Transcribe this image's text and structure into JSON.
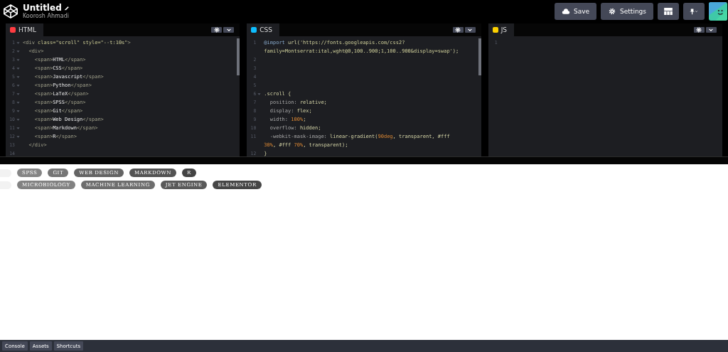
{
  "header": {
    "title": "Untitled",
    "author": "Koorosh Ahmadi",
    "buttons": [
      {
        "kind": "save",
        "label": "Save"
      },
      {
        "kind": "settings",
        "label": "Settings"
      },
      {
        "kind": "layout"
      },
      {
        "kind": "pin"
      }
    ]
  },
  "editors": [
    {
      "kind": "html",
      "title": "HTML",
      "lines": [
        {
          "number": "1",
          "fold": true,
          "segments": [
            {
              "kind": "tag",
              "text": "<div "
            },
            {
              "kind": "attr",
              "text": "class="
            },
            {
              "kind": "str",
              "text": "\"scroll\" "
            },
            {
              "kind": "attr",
              "text": "style="
            },
            {
              "kind": "str",
              "text": "\"--t:10s\""
            },
            {
              "kind": "tag",
              "text": ">"
            }
          ]
        },
        {
          "number": "2",
          "fold": true,
          "segments": [
            {
              "kind": "tag",
              "text": "  <div>"
            }
          ]
        },
        {
          "number": "3",
          "fold": true,
          "segments": [
            {
              "kind": "tag",
              "text": "    <span>"
            },
            {
              "kind": "text",
              "text": "HTML"
            },
            {
              "kind": "tag",
              "text": "</span>"
            }
          ]
        },
        {
          "number": "4",
          "fold": true,
          "segments": [
            {
              "kind": "tag",
              "text": "    <span>"
            },
            {
              "kind": "text",
              "text": "CSS"
            },
            {
              "kind": "tag",
              "text": "</span>"
            }
          ]
        },
        {
          "number": "5",
          "fold": true,
          "segments": [
            {
              "kind": "tag",
              "text": "    <span>"
            },
            {
              "kind": "text",
              "text": "Javascript"
            },
            {
              "kind": "tag",
              "text": "</span>"
            }
          ]
        },
        {
          "number": "6",
          "fold": true,
          "segments": [
            {
              "kind": "tag",
              "text": "    <span>"
            },
            {
              "kind": "text",
              "text": "Python"
            },
            {
              "kind": "tag",
              "text": "</span>"
            }
          ]
        },
        {
          "number": "7",
          "fold": true,
          "segments": [
            {
              "kind": "tag",
              "text": "    <span>"
            },
            {
              "kind": "text",
              "text": "LaTeX"
            },
            {
              "kind": "tag",
              "text": "</span>"
            }
          ]
        },
        {
          "number": "8",
          "fold": true,
          "segments": [
            {
              "kind": "tag",
              "text": "    <span>"
            },
            {
              "kind": "text",
              "text": "SPSS"
            },
            {
              "kind": "tag",
              "text": "</span>"
            }
          ]
        },
        {
          "number": "9",
          "fold": true,
          "segments": [
            {
              "kind": "tag",
              "text": "    <span>"
            },
            {
              "kind": "text",
              "text": "Git"
            },
            {
              "kind": "tag",
              "text": "</span>"
            }
          ]
        },
        {
          "number": "10",
          "fold": true,
          "segments": [
            {
              "kind": "tag",
              "text": "    <span>"
            },
            {
              "kind": "text",
              "text": "Web Design"
            },
            {
              "kind": "tag",
              "text": "</span>"
            }
          ]
        },
        {
          "number": "11",
          "fold": true,
          "segments": [
            {
              "kind": "tag",
              "text": "    <span>"
            },
            {
              "kind": "text",
              "text": "Markdown"
            },
            {
              "kind": "tag",
              "text": "</span>"
            }
          ]
        },
        {
          "number": "12",
          "fold": true,
          "segments": [
            {
              "kind": "tag",
              "text": "    <span>"
            },
            {
              "kind": "text",
              "text": "R"
            },
            {
              "kind": "tag",
              "text": "</span>"
            }
          ]
        },
        {
          "number": "13",
          "fold": false,
          "segments": [
            {
              "kind": "tag",
              "text": "  </div>"
            }
          ]
        },
        {
          "number": "14",
          "fold": false
        }
      ]
    },
    {
      "kind": "css",
      "title": "CSS",
      "lines": [
        {
          "number": "1",
          "fold": false,
          "segments": [
            {
              "kind": "at",
              "text": "@import "
            },
            {
              "kind": "val",
              "text": "url("
            },
            {
              "kind": "str",
              "text": "'https://fonts.googleapis.com/css2?"
            }
          ],
          "continuation": [
            {
              "kind": "str",
              "text": "family=Montserrat:ital,wght@0,100..900;1,100..900&display=swap'"
            },
            {
              "kind": "val",
              "text": ");"
            }
          ]
        },
        {
          "number": "2",
          "fold": false
        },
        {
          "number": "3",
          "fold": false
        },
        {
          "number": "4",
          "fold": false
        },
        {
          "number": "5",
          "fold": false
        },
        {
          "number": "6",
          "fold": true,
          "segments": [
            {
              "kind": "val",
              "text": ".scroll {"
            }
          ]
        },
        {
          "number": "7",
          "fold": false,
          "segments": [
            {
              "kind": "prop",
              "text": "  position: "
            },
            {
              "kind": "val",
              "text": "relative;"
            }
          ]
        },
        {
          "number": "8",
          "fold": false,
          "segments": [
            {
              "kind": "prop",
              "text": "  display: "
            },
            {
              "kind": "val",
              "text": "flex;"
            }
          ]
        },
        {
          "number": "9",
          "fold": false,
          "segments": [
            {
              "kind": "prop",
              "text": "  width: "
            },
            {
              "kind": "num",
              "text": "100%"
            },
            {
              "kind": "val",
              "text": ";"
            }
          ]
        },
        {
          "number": "10",
          "fold": false,
          "segments": [
            {
              "kind": "prop",
              "text": "  overflow: "
            },
            {
              "kind": "val",
              "text": "hidden;"
            }
          ]
        },
        {
          "number": "11",
          "fold": false,
          "segments": [
            {
              "kind": "prop",
              "text": "  -webkit-mask-image: "
            },
            {
              "kind": "val",
              "text": "linear-gradient("
            },
            {
              "kind": "num",
              "text": "90deg"
            },
            {
              "kind": "val",
              "text": ", transparent, #fff"
            }
          ],
          "continuation": [
            {
              "kind": "num",
              "text": "30%"
            },
            {
              "kind": "val",
              "text": ", #fff "
            },
            {
              "kind": "num",
              "text": "70%"
            },
            {
              "kind": "val",
              "text": ", transparent);"
            }
          ]
        },
        {
          "number": "12",
          "fold": false,
          "segments": [
            {
              "kind": "val",
              "text": "}"
            }
          ]
        }
      ]
    },
    {
      "kind": "js",
      "title": "JS",
      "lines": [
        {
          "number": "1",
          "fold": false
        }
      ]
    }
  ],
  "preview": {
    "rows": [
      {
        "tags": [
          "SPSS",
          "GIT",
          "WEB DESIGN",
          "MARKDOWN",
          "R"
        ]
      },
      {
        "tags": [
          "MICROBIOLOGY",
          "MACHINE LEARNING",
          "JET ENGINE",
          "ELEMENTOR"
        ]
      }
    ]
  },
  "footer": [
    "Console",
    "Assets",
    "Shortcuts"
  ]
}
